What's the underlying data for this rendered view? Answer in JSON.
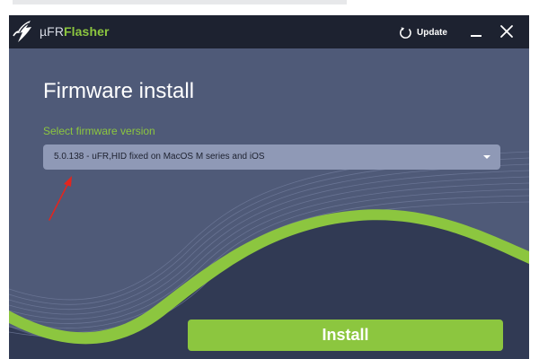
{
  "titlebar": {
    "app_name_prefix": "µFR",
    "app_name_suffix": "Flasher",
    "update_label": "Update"
  },
  "main": {
    "page_title": "Firmware install",
    "firmware_select": {
      "label": "Select firmware version",
      "selected_value": "5.0.138 - uFR,HID fixed on MacOS M series and iOS"
    },
    "install_label": "Install"
  },
  "icons": {
    "logo": "bolt-logo-icon",
    "update": "refresh-icon",
    "minimize": "minimize-icon",
    "close": "close-icon",
    "dropdown": "caret-down-icon"
  },
  "colors": {
    "accent_green": "#8cc63f",
    "background": "#4f5a78",
    "titlebar": "#1d2230",
    "select_background": "#8f99b6",
    "annotation_red": "#e1261f"
  }
}
